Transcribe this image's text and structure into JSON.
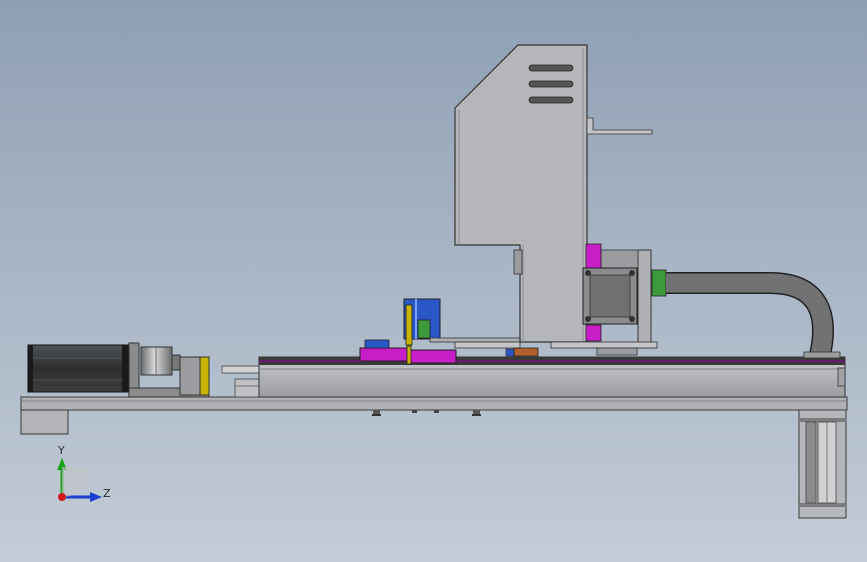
{
  "view": {
    "background_top": "#8f9fb3",
    "background_bottom": "#c3ccd7"
  },
  "triad": {
    "y_label": "Y",
    "z_label": "Z",
    "y_color": "#1aa01a",
    "z_color": "#1a3fd0",
    "origin_color": "#d01a1a"
  },
  "colors": {
    "steel": "#8a8c8e",
    "steel_dark": "#6e7072",
    "steel_light": "#b8babd",
    "motor_black": "#2b2d2f",
    "magenta": "#c81ec8",
    "blue": "#2a57c8",
    "yellow": "#c8b400",
    "green": "#3c9a3c",
    "brown": "#b0602a",
    "hose": "#707274"
  }
}
